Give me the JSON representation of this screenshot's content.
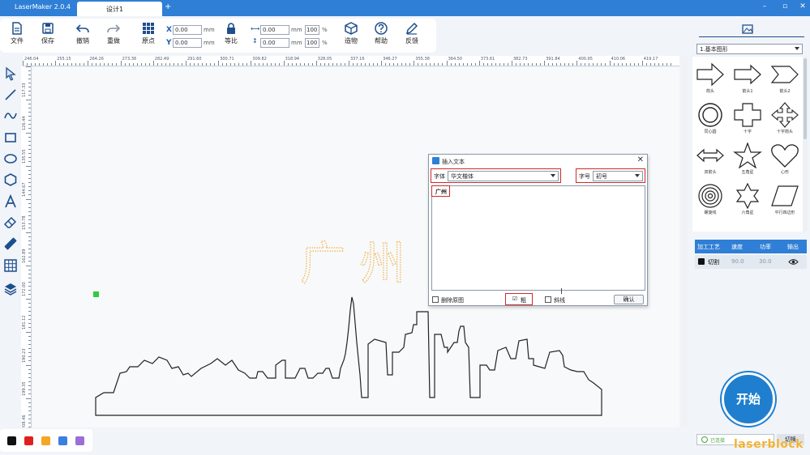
{
  "app": {
    "title": "LaserMaker 2.0.4",
    "tab": "设计1",
    "tab_add": "+",
    "win_min": "–",
    "win_max": "▫",
    "win_close": "✕"
  },
  "toolbar": {
    "file": "文件",
    "save": "保存",
    "undo": "撤销",
    "redo": "重做",
    "origin": "原点",
    "x_label": "X",
    "y_label": "Y",
    "x_value": "0.00",
    "y_value": "0.00",
    "mm": "mm",
    "lock": "等比",
    "w_value": "0.00",
    "h_value": "0.00",
    "w_pct": "100",
    "h_pct": "100",
    "pct": "%",
    "build": "造物",
    "help": "帮助",
    "feedback": "反馈"
  },
  "left_tools": [
    "select-icon",
    "line-icon",
    "curve-icon",
    "rectangle-icon",
    "ellipse-icon",
    "polygon-icon",
    "text-icon",
    "eraser-icon",
    "ruler-icon",
    "grid-icon",
    "layers-icon"
  ],
  "ruler": {
    "top": [
      "246.04",
      "255.15",
      "264.26",
      "273.38",
      "282.49",
      "291.60",
      "300.71",
      "309.82",
      "318.94",
      "328.05",
      "337.16",
      "346.27",
      "355.38",
      "364.50",
      "373.61",
      "382.73",
      "391.84",
      "400.95",
      "410.06",
      "419.17"
    ],
    "left": [
      "117.33",
      "126.44",
      "135.55",
      "144.67",
      "153.78",
      "162.89",
      "172.00",
      "181.12",
      "190.23",
      "199.35",
      "208.46"
    ]
  },
  "canvas": {
    "preview_text": "广 州"
  },
  "dialog": {
    "title": "插入文本",
    "close": "✕",
    "font_label": "字体",
    "font_value": "华文楷体",
    "size_label": "字号",
    "size_value": "初号",
    "text": "广州",
    "delete_original": "删除原图",
    "bold_label": "粗",
    "bold_check": "☑",
    "italic_label": "斜线",
    "ok": "确认"
  },
  "right_panel": {
    "library": "1.基本图形",
    "shapes": [
      {
        "label": "箭头",
        "icon": "arrow-shape-icon"
      },
      {
        "label": "箭头1",
        "icon": "arrow1-shape-icon"
      },
      {
        "label": "箭头2",
        "icon": "arrow2-shape-icon"
      },
      {
        "label": "同心圆",
        "icon": "concentric-circle-icon"
      },
      {
        "label": "十字",
        "icon": "cross-shape-icon"
      },
      {
        "label": "十字箭头",
        "icon": "cross-arrow-icon"
      },
      {
        "label": "双箭头",
        "icon": "double-arrow-icon"
      },
      {
        "label": "五角星",
        "icon": "five-star-icon"
      },
      {
        "label": "心形",
        "icon": "heart-shape-icon"
      },
      {
        "label": "螺旋线",
        "icon": "spiral-icon"
      },
      {
        "label": "六角星",
        "icon": "six-star-icon"
      },
      {
        "label": "平行四边形",
        "icon": "parallelogram-icon"
      }
    ],
    "layer_headers": [
      "加工工艺",
      "速度",
      "功率",
      "输出"
    ],
    "layer_row": {
      "process": "切割",
      "speed": "90.0",
      "power": "30.0",
      "color": "#111111"
    },
    "start": "开始",
    "status": "已连接",
    "switch": "切换",
    "watermark": "laserblock"
  },
  "palette": [
    "#111111",
    "#e02020",
    "#f5a623",
    "#3b7fe0",
    "#9b6fd6"
  ]
}
